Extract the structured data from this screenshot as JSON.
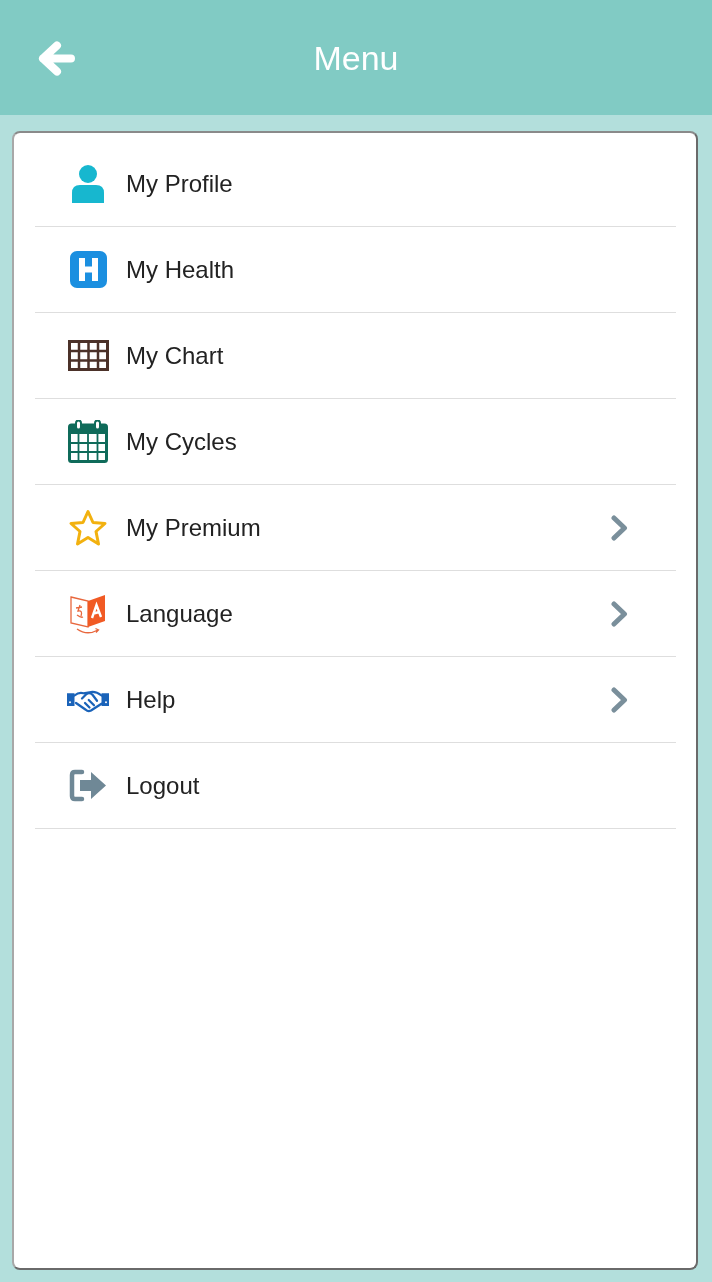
{
  "header": {
    "title": "Menu"
  },
  "menu": {
    "items": [
      {
        "kind": "profile",
        "label": "My Profile",
        "submenu": false
      },
      {
        "kind": "health",
        "label": "My Health",
        "submenu": false
      },
      {
        "kind": "chart",
        "label": "My Chart",
        "submenu": false
      },
      {
        "kind": "cycles",
        "label": "My Cycles",
        "submenu": false
      },
      {
        "kind": "premium",
        "label": "My Premium",
        "submenu": true
      },
      {
        "kind": "language",
        "label": "Language",
        "submenu": true
      },
      {
        "kind": "help",
        "label": "Help",
        "submenu": true
      },
      {
        "kind": "logout",
        "label": "Logout",
        "submenu": false
      }
    ]
  }
}
